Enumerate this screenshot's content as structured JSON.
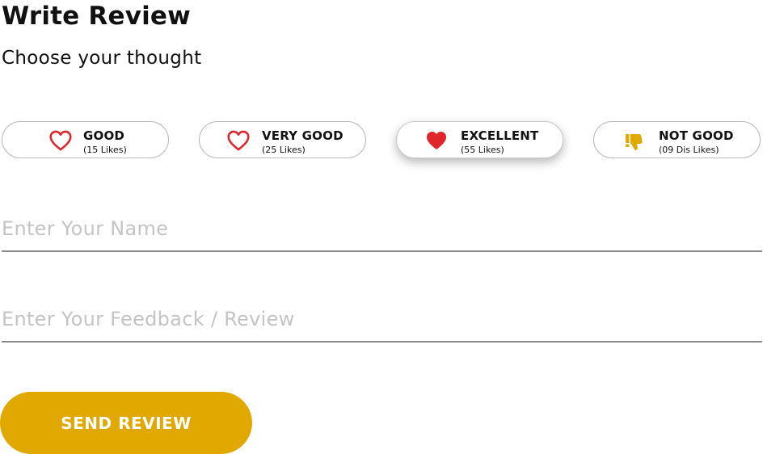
{
  "header": {
    "title": "Write Review",
    "subtitle": "Choose your thought"
  },
  "options": [
    {
      "label": "GOOD",
      "count": "(15 Likes)",
      "icon": "heart-outline-icon",
      "selected": false
    },
    {
      "label": "VERY GOOD",
      "count": "(25 Likes)",
      "icon": "heart-outline-icon",
      "selected": false
    },
    {
      "label": "EXCELLENT",
      "count": "(55 Likes)",
      "icon": "heart-filled-icon",
      "selected": true
    },
    {
      "label": "NOT GOOD",
      "count": "(09 Dis Likes)",
      "icon": "thumbs-down-icon",
      "selected": false
    }
  ],
  "form": {
    "name_placeholder": "Enter Your Name",
    "name_value": "",
    "feedback_placeholder": "Enter Your Feedback / Review",
    "feedback_value": ""
  },
  "actions": {
    "send_label": "SEND REVIEW"
  },
  "colors": {
    "accent": "#E0A800",
    "heart": "#E0262D",
    "border": "#B9B9B9",
    "placeholder": "#C4C4C4"
  }
}
